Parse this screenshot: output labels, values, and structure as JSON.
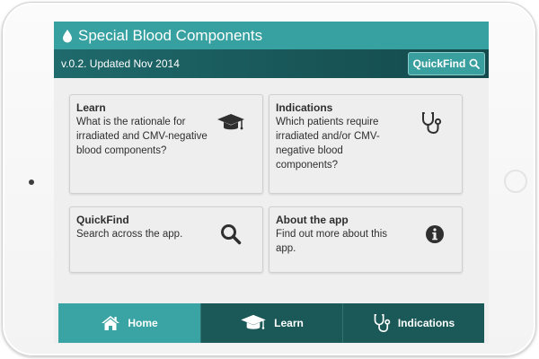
{
  "app": {
    "title": "Special Blood Components",
    "version": "v.0.2. Updated Nov 2014",
    "quickfind_label": "QuickFind"
  },
  "cards": [
    {
      "title": "Learn",
      "description": "What is the rationale for irradiated and CMV-negative blood components?",
      "icon": "mortarboard-icon"
    },
    {
      "title": "Indications",
      "description": "Which patients require irradiated and/or CMV-negative blood components?",
      "icon": "stethoscope-icon"
    },
    {
      "title": "QuickFind",
      "description": "Search across the app.",
      "icon": "search-icon"
    },
    {
      "title": "About the app",
      "description": "Find out more about this app.",
      "icon": "info-icon"
    }
  ],
  "tabs": [
    {
      "label": "Home",
      "icon": "home-icon",
      "active": true
    },
    {
      "label": "Learn",
      "icon": "mortarboard-icon",
      "active": false
    },
    {
      "label": "Indications",
      "icon": "stethoscope-icon",
      "active": false
    }
  ],
  "colors": {
    "title_bar": "#37a0a0",
    "version_bar": "#1d6163",
    "tab_active": "#3aa3a3",
    "tab_inactive": "#1b5858",
    "card_bg": "#eeeeee"
  }
}
